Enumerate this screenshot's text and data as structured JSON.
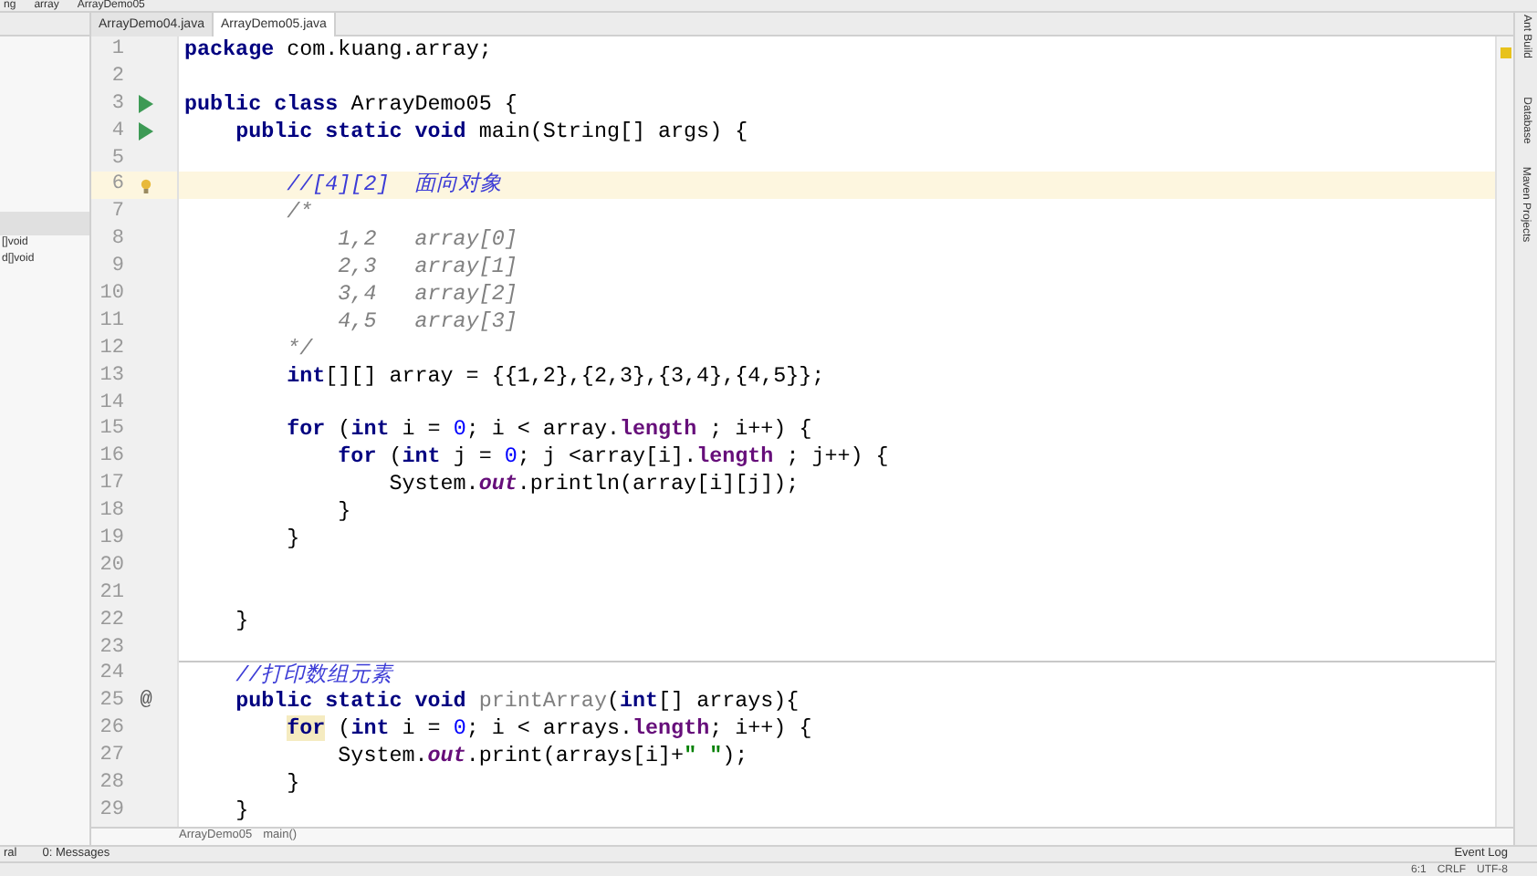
{
  "nav_bar": [
    "ng",
    "array",
    "ArrayDemo05"
  ],
  "project_panel": {
    "items": [
      "[]void",
      "d[]void"
    ]
  },
  "tabs": [
    {
      "label": "ArrayDemo04.java",
      "selected": false
    },
    {
      "label": "ArrayDemo05.java",
      "selected": true
    }
  ],
  "editor": {
    "lines": [
      {
        "number": "1",
        "tokens": [
          {
            "kind": "keyword",
            "text": "package"
          },
          {
            "kind": "plain",
            "text": " com.kuang.array;"
          }
        ]
      },
      {
        "number": "2"
      },
      {
        "number": "3",
        "kind": "run",
        "tokens": [
          {
            "kind": "keyword",
            "text": "public class"
          },
          {
            "kind": "plain",
            "text": " ArrayDemo05 {"
          }
        ]
      },
      {
        "number": "4",
        "kind": "run",
        "tokens": [
          {
            "kind": "keyword",
            "text": "    public static void"
          },
          {
            "kind": "plain",
            "text": " main(String[] args) {"
          }
        ]
      },
      {
        "number": "5"
      },
      {
        "number": "6",
        "kind": "bulb",
        "current": true,
        "tokens": [
          {
            "kind": "line_comment",
            "text": "        //[4][2]  面向对象"
          }
        ]
      },
      {
        "number": "7",
        "tokens": [
          {
            "kind": "block_comment",
            "text": "        /*"
          }
        ]
      },
      {
        "number": "8",
        "tokens": [
          {
            "kind": "block_comment",
            "text": "            1,2   array[0]"
          }
        ]
      },
      {
        "number": "9",
        "tokens": [
          {
            "kind": "block_comment",
            "text": "            2,3   array[1]"
          }
        ]
      },
      {
        "number": "10",
        "tokens": [
          {
            "kind": "block_comment",
            "text": "            3,4   array[2]"
          }
        ]
      },
      {
        "number": "11",
        "tokens": [
          {
            "kind": "block_comment",
            "text": "            4,5   array[3]"
          }
        ]
      },
      {
        "number": "12",
        "tokens": [
          {
            "kind": "block_comment",
            "text": "        */"
          }
        ]
      },
      {
        "number": "13",
        "tokens": [
          {
            "kind": "keyword",
            "text": "        int"
          },
          {
            "kind": "plain",
            "text": "[][] array = {{1,2},{2,3},{3,4},{4,5}};"
          }
        ]
      },
      {
        "number": "14"
      },
      {
        "number": "15",
        "tokens": [
          {
            "kind": "keyword",
            "text": "        for"
          },
          {
            "kind": "plain",
            "text": " ("
          },
          {
            "kind": "keyword",
            "text": "int"
          },
          {
            "kind": "plain",
            "text": " i = "
          },
          {
            "kind": "number",
            "text": "0"
          },
          {
            "kind": "plain",
            "text": "; i < array."
          },
          {
            "kind": "field",
            "text": "length"
          },
          {
            "kind": "plain",
            "text": " ; i++) {"
          }
        ]
      },
      {
        "number": "16",
        "tokens": [
          {
            "kind": "keyword",
            "text": "            for"
          },
          {
            "kind": "plain",
            "text": " ("
          },
          {
            "kind": "keyword",
            "text": "int"
          },
          {
            "kind": "plain",
            "text": " j = "
          },
          {
            "kind": "number",
            "text": "0"
          },
          {
            "kind": "plain",
            "text": "; j <array[i]."
          },
          {
            "kind": "field",
            "text": "length"
          },
          {
            "kind": "plain",
            "text": " ; j++) {"
          }
        ]
      },
      {
        "number": "17",
        "tokens": [
          {
            "kind": "plain",
            "text": "                System."
          },
          {
            "kind": "static_field",
            "text": "out"
          },
          {
            "kind": "plain",
            "text": ".println(array[i][j]);"
          }
        ]
      },
      {
        "number": "18",
        "tokens": [
          {
            "kind": "plain",
            "text": "            }"
          }
        ]
      },
      {
        "number": "19",
        "tokens": [
          {
            "kind": "plain",
            "text": "        }"
          }
        ]
      },
      {
        "number": "20"
      },
      {
        "number": "21"
      },
      {
        "number": "22",
        "tokens": [
          {
            "kind": "plain",
            "text": "    }"
          }
        ]
      },
      {
        "number": "23"
      },
      {
        "number": "24",
        "method_separator": true,
        "tokens": [
          {
            "kind": "line_comment",
            "text": "    //打印数组元素"
          }
        ]
      },
      {
        "number": "25",
        "kind": "override",
        "marker": "@",
        "tokens": [
          {
            "kind": "keyword",
            "text": "    public static void"
          },
          {
            "kind": "unused",
            "text": " printArray"
          },
          {
            "kind": "plain",
            "text": "("
          },
          {
            "kind": "keyword",
            "text": "int"
          },
          {
            "kind": "plain",
            "text": "[] arrays){"
          }
        ]
      },
      {
        "number": "26",
        "tokens": [
          {
            "kind": "keyword",
            "text": "        for",
            "marked": true
          },
          {
            "kind": "plain",
            "text": " ("
          },
          {
            "kind": "keyword",
            "text": "int"
          },
          {
            "kind": "plain",
            "text": " i = "
          },
          {
            "kind": "number",
            "text": "0"
          },
          {
            "kind": "plain",
            "text": "; i < arrays."
          },
          {
            "kind": "field",
            "text": "length"
          },
          {
            "kind": "plain",
            "text": "; i++) {"
          }
        ]
      },
      {
        "number": "27",
        "tokens": [
          {
            "kind": "plain",
            "text": "            System."
          },
          {
            "kind": "static_field",
            "text": "out"
          },
          {
            "kind": "plain",
            "text": ".print(arrays[i]+"
          },
          {
            "kind": "string",
            "text": "\" \""
          },
          {
            "kind": "plain",
            "text": ");"
          }
        ]
      },
      {
        "number": "28",
        "tokens": [
          {
            "kind": "plain",
            "text": "        }"
          }
        ]
      },
      {
        "number": "29",
        "tokens": [
          {
            "kind": "plain",
            "text": "    }"
          }
        ]
      }
    ]
  },
  "breadcrumb": [
    "ArrayDemo05",
    "main()"
  ],
  "right_tools": [
    "Ant Build",
    "Database",
    "Maven Projects"
  ],
  "bottom_tabs": [
    "ral",
    "0: Messages"
  ],
  "status_bar": {
    "event_log": "Event Log",
    "position": "6:1",
    "line_separator": "CRLF",
    "encoding": "UTF-8"
  }
}
